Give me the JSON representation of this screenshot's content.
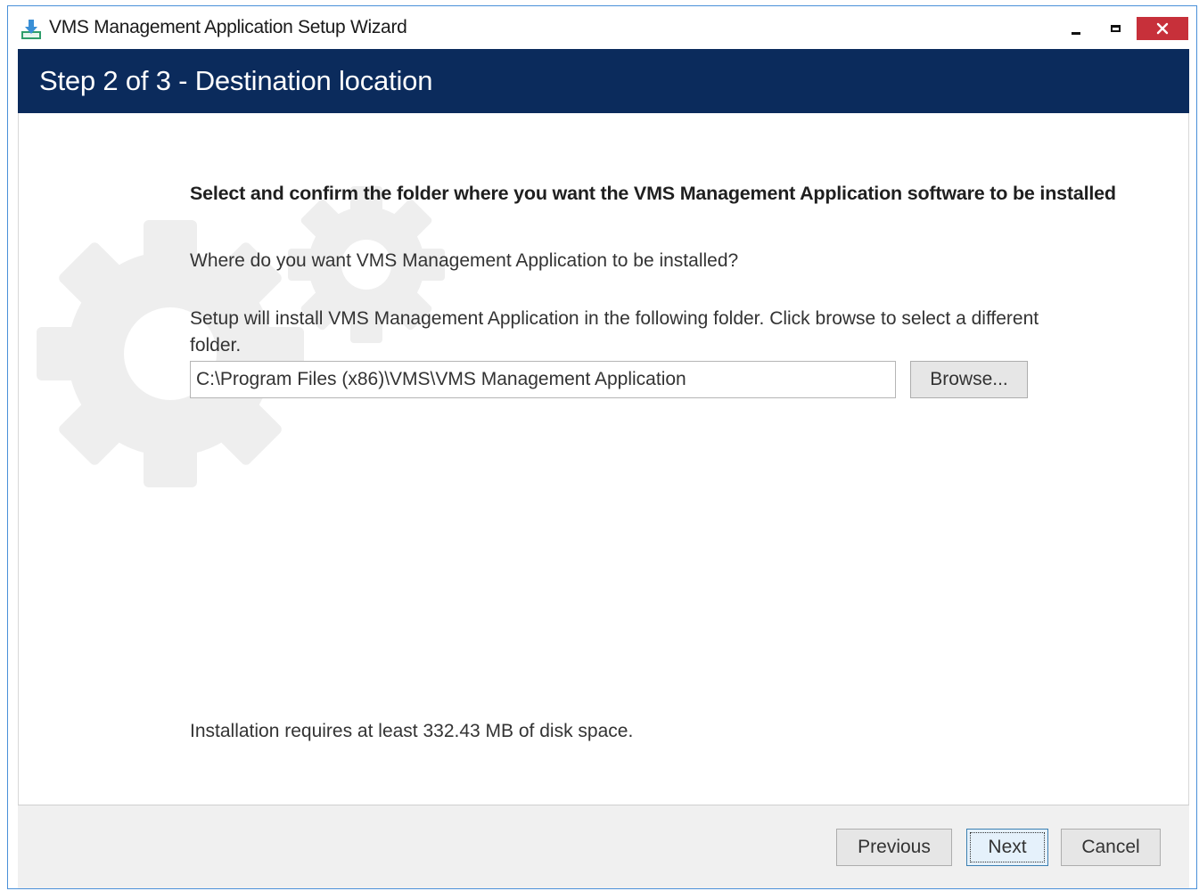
{
  "window": {
    "title": "VMS Management Application Setup Wizard",
    "controls": {
      "minimize_icon": "minimize-icon",
      "maximize_icon": "maximize-icon",
      "close_icon": "close-icon",
      "close_color": "#c7303a"
    }
  },
  "header": {
    "step_title": "Step 2 of 3 - Destination location",
    "background_color": "#0b2b5c"
  },
  "content": {
    "heading": "Select and confirm the folder where you want the VMS Management Application software to be installed",
    "question": "Where do you want VMS Management Application to be installed?",
    "info": "Setup will install VMS Management Application in the following folder. Click browse to select a different folder.",
    "install_path": "C:\\Program Files (x86)\\VMS\\VMS Management Application",
    "browse_label": "Browse...",
    "disk_space_note": "Installation requires at least 332.43 MB of disk space."
  },
  "footer": {
    "previous_label": "Previous",
    "next_label": "Next",
    "cancel_label": "Cancel"
  }
}
